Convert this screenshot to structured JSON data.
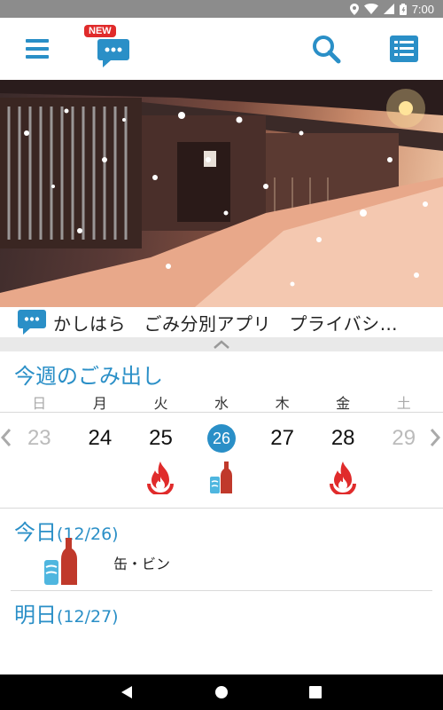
{
  "status_bar": {
    "time": "7:00"
  },
  "app_bar": {
    "new_badge": "NEW"
  },
  "ticker": {
    "text": "かしはら　ごみ分別アプリ　プライバシ…"
  },
  "week": {
    "title": "今週のごみ出し",
    "weekdays": [
      "日",
      "月",
      "火",
      "水",
      "木",
      "金",
      "土"
    ],
    "dates": [
      "23",
      "24",
      "25",
      "26",
      "27",
      "28",
      "29"
    ],
    "today_index": 3,
    "collections": [
      "",
      "",
      "burnable",
      "cans-bottles",
      "",
      "burnable",
      ""
    ]
  },
  "today": {
    "label": "今日",
    "date": "(12/26)",
    "item": "缶・ビン"
  },
  "tomorrow": {
    "label": "明日",
    "date": "(12/27)"
  },
  "colors": {
    "accent": "#2a8fc7",
    "fire": "#e02b2b",
    "bottle": "#c0392b",
    "can": "#4fb6df"
  }
}
